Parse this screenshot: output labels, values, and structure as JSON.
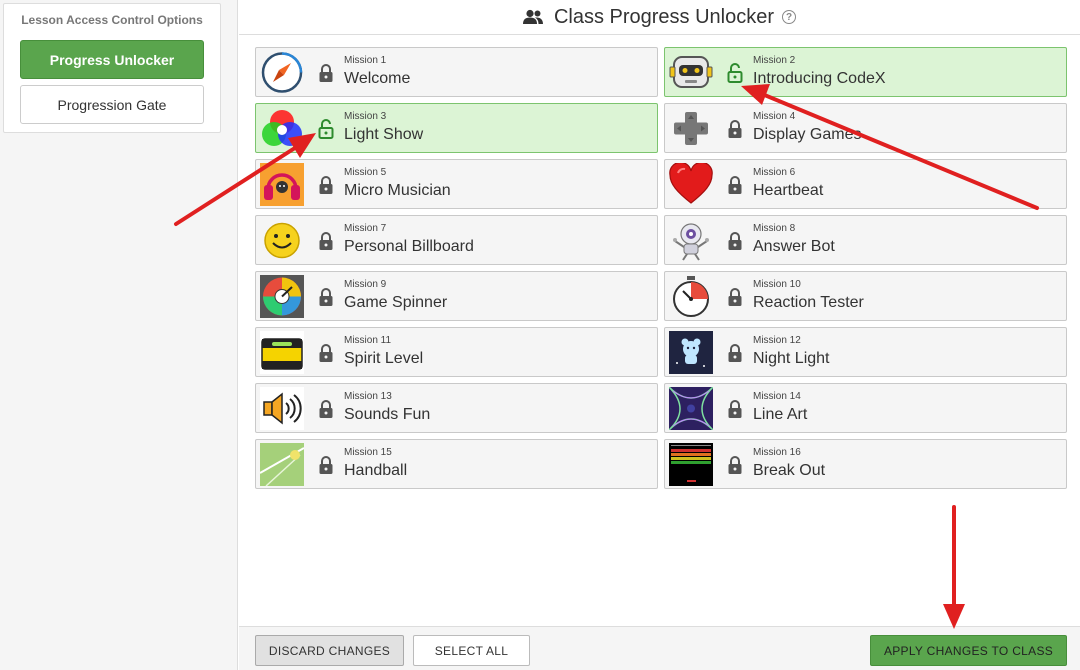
{
  "sidebar": {
    "title": "Lesson Access Control Options",
    "options": [
      {
        "label": "Progress Unlocker",
        "active": true
      },
      {
        "label": "Progression Gate",
        "active": false
      }
    ]
  },
  "header": {
    "title": "Class Progress Unlocker",
    "help": "?"
  },
  "missions": [
    {
      "number": "Mission 1",
      "name": "Welcome",
      "unlocked": false,
      "icon": "compass-icon"
    },
    {
      "number": "Mission 2",
      "name": "Introducing CodeX",
      "unlocked": true,
      "icon": "robot-icon"
    },
    {
      "number": "Mission 3",
      "name": "Light Show",
      "unlocked": true,
      "icon": "rgb-circles-icon"
    },
    {
      "number": "Mission 4",
      "name": "Display Games",
      "unlocked": false,
      "icon": "dpad-icon"
    },
    {
      "number": "Mission 5",
      "name": "Micro Musician",
      "unlocked": false,
      "icon": "headphones-icon"
    },
    {
      "number": "Mission 6",
      "name": "Heartbeat",
      "unlocked": false,
      "icon": "heart-icon"
    },
    {
      "number": "Mission 7",
      "name": "Personal Billboard",
      "unlocked": false,
      "icon": "smiley-icon"
    },
    {
      "number": "Mission 8",
      "name": "Answer Bot",
      "unlocked": false,
      "icon": "bot-icon"
    },
    {
      "number": "Mission 9",
      "name": "Game Spinner",
      "unlocked": false,
      "icon": "spinner-icon"
    },
    {
      "number": "Mission 10",
      "name": "Reaction Tester",
      "unlocked": false,
      "icon": "stopwatch-icon"
    },
    {
      "number": "Mission 11",
      "name": "Spirit Level",
      "unlocked": false,
      "icon": "spirit-level-icon"
    },
    {
      "number": "Mission 12",
      "name": "Night Light",
      "unlocked": false,
      "icon": "night-light-icon"
    },
    {
      "number": "Mission 13",
      "name": "Sounds Fun",
      "unlocked": false,
      "icon": "speaker-icon"
    },
    {
      "number": "Mission 14",
      "name": "Line Art",
      "unlocked": false,
      "icon": "line-art-icon"
    },
    {
      "number": "Mission 15",
      "name": "Handball",
      "unlocked": false,
      "icon": "handball-icon"
    },
    {
      "number": "Mission 16",
      "name": "Break Out",
      "unlocked": false,
      "icon": "breakout-icon"
    }
  ],
  "footer": {
    "discard": "DISCARD CHANGES",
    "select_all": "SELECT ALL",
    "apply": "APPLY CHANGES TO CLASS"
  },
  "colors": {
    "accent_green": "#5aa54d",
    "unlocked_bg": "#dcf4d5",
    "arrow_red": "#e02020"
  }
}
